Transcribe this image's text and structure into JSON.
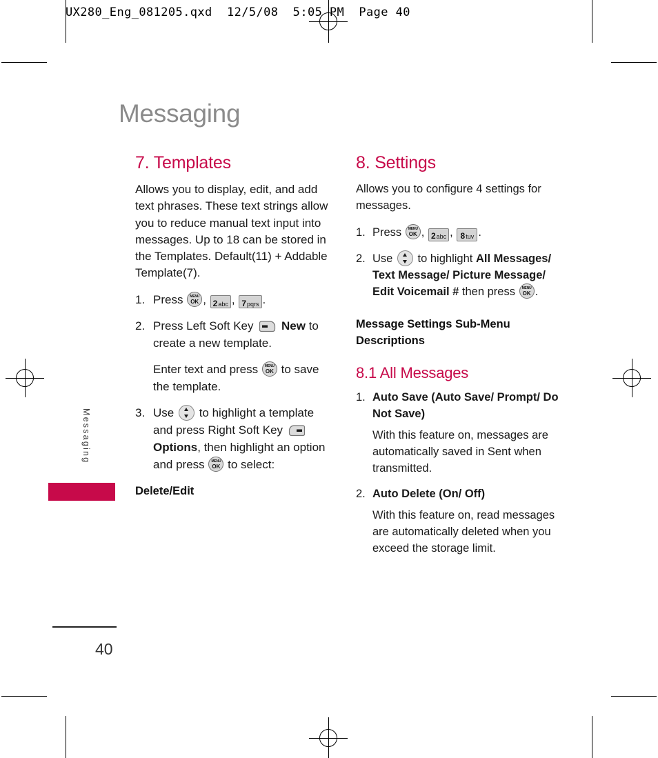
{
  "file_header": "UX280_Eng_081205.qxd  12/5/08  5:05 PM  Page 40",
  "page": {
    "title": "Messaging",
    "side_tab_label": "Messaging",
    "number": "40"
  },
  "icons": {
    "menu_ok_top": "MENU",
    "menu_ok_bottom": "OK",
    "key_2_digit": "2",
    "key_2_letters": "abc",
    "key_7_digit": "7",
    "key_7_letters": "pqrs",
    "key_8_digit": "8",
    "key_8_letters": "tuv",
    "nav_key_name": "navigation-key",
    "left_soft_key_name": "left-soft-key",
    "right_soft_key_name": "right-soft-key"
  },
  "colors": {
    "accent": "#c70a4a",
    "title_gray": "#8b8b8b"
  },
  "left_column": {
    "heading": "7. Templates",
    "intro": "Allows you to display, edit, and add text phrases. These text strings allow you to reduce manual text input into messages. Up to 18 can be stored in the Templates. Default(11) + Addable Template(7).",
    "step1": {
      "num": "1.",
      "pre": "Press",
      "sep1": ",",
      "sep2": ",",
      "end": "."
    },
    "step2": {
      "num": "2.",
      "pre": "Press Left Soft Key",
      "bold": "New",
      "post": "to create a new template."
    },
    "step2b": {
      "pre": "Enter text and press",
      "post": "to"
    },
    "step2b_line2": "save the template.",
    "step3": {
      "num": "3.",
      "pre": "Use",
      "mid": "to highlight a template and press Right Soft Key",
      "bold": "Options",
      "post": ", then highlight an option and press",
      "end": "to select:"
    },
    "options_list": "Delete/Edit"
  },
  "right_column": {
    "heading": "8. Settings",
    "intro": "Allows you to configure 4 settings for messages.",
    "step1": {
      "num": "1.",
      "pre": "Press",
      "sep1": ",",
      "sep2": ",",
      "end": "."
    },
    "step2": {
      "num": "2.",
      "pre": "Use",
      "mid": "to highlight",
      "bold": "All Messages/ Text Message/ Picture Message/ Edit Voicemail #",
      "post": "then press",
      "end": "."
    },
    "submenu_heading": "Message Settings Sub-Menu Descriptions",
    "subsection_heading": "8.1 All Messages",
    "items": [
      {
        "num": "1.",
        "title": "Auto Save (Auto Save/ Prompt/ Do Not Save)",
        "body": "With this feature on, messages are automatically saved in Sent when transmitted."
      },
      {
        "num": "2.",
        "title": "Auto Delete (On/ Off)",
        "body": "With this feature on, read messages are automatically deleted when you exceed the storage limit."
      }
    ]
  }
}
